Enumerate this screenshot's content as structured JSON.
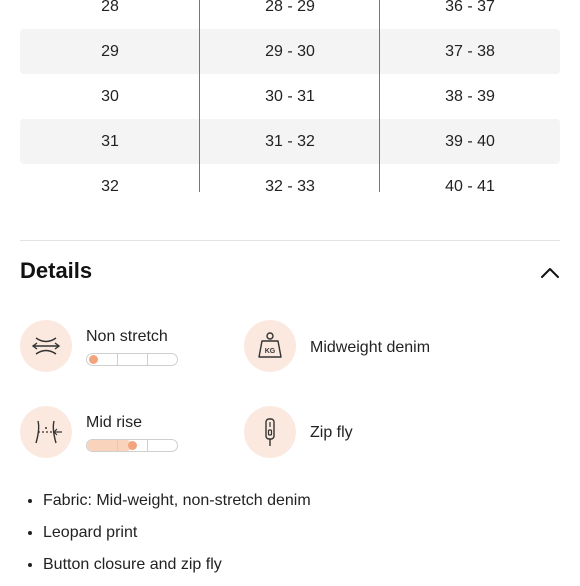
{
  "size_table": {
    "rows": [
      {
        "col1": "28",
        "col2": "28 - 29",
        "col3": "36 - 37",
        "shaded": false
      },
      {
        "col1": "29",
        "col2": "29 - 30",
        "col3": "37 - 38",
        "shaded": true
      },
      {
        "col1": "30",
        "col2": "30 - 31",
        "col3": "38 - 39",
        "shaded": false
      },
      {
        "col1": "31",
        "col2": "31 - 32",
        "col3": "39 - 40",
        "shaded": true
      },
      {
        "col1": "32",
        "col2": "32 - 33",
        "col3": "40 - 41",
        "shaded": false
      }
    ]
  },
  "details": {
    "title": "Details",
    "collapse_icon": "chevron-up-icon",
    "features": {
      "stretch": {
        "label": "Non stretch",
        "icon": "stretch-arrows-icon",
        "level": 0
      },
      "weight": {
        "label": "Midweight denim",
        "icon": "weight-kg-icon",
        "icon_text": "KG"
      },
      "rise": {
        "label": "Mid rise",
        "icon": "waist-rise-icon",
        "level": 0.5
      },
      "fly": {
        "label": "Zip fly",
        "icon": "zipper-icon"
      }
    },
    "bullets": [
      "Fabric: Mid-weight, non-stretch denim",
      "Leopard print",
      "Button closure and zip fly"
    ]
  },
  "colors": {
    "accent": "#f2a57c",
    "accent_light": "#f9d3bb",
    "icon_bg": "#fbe9e0",
    "row_shade": "#f4f4f4"
  }
}
